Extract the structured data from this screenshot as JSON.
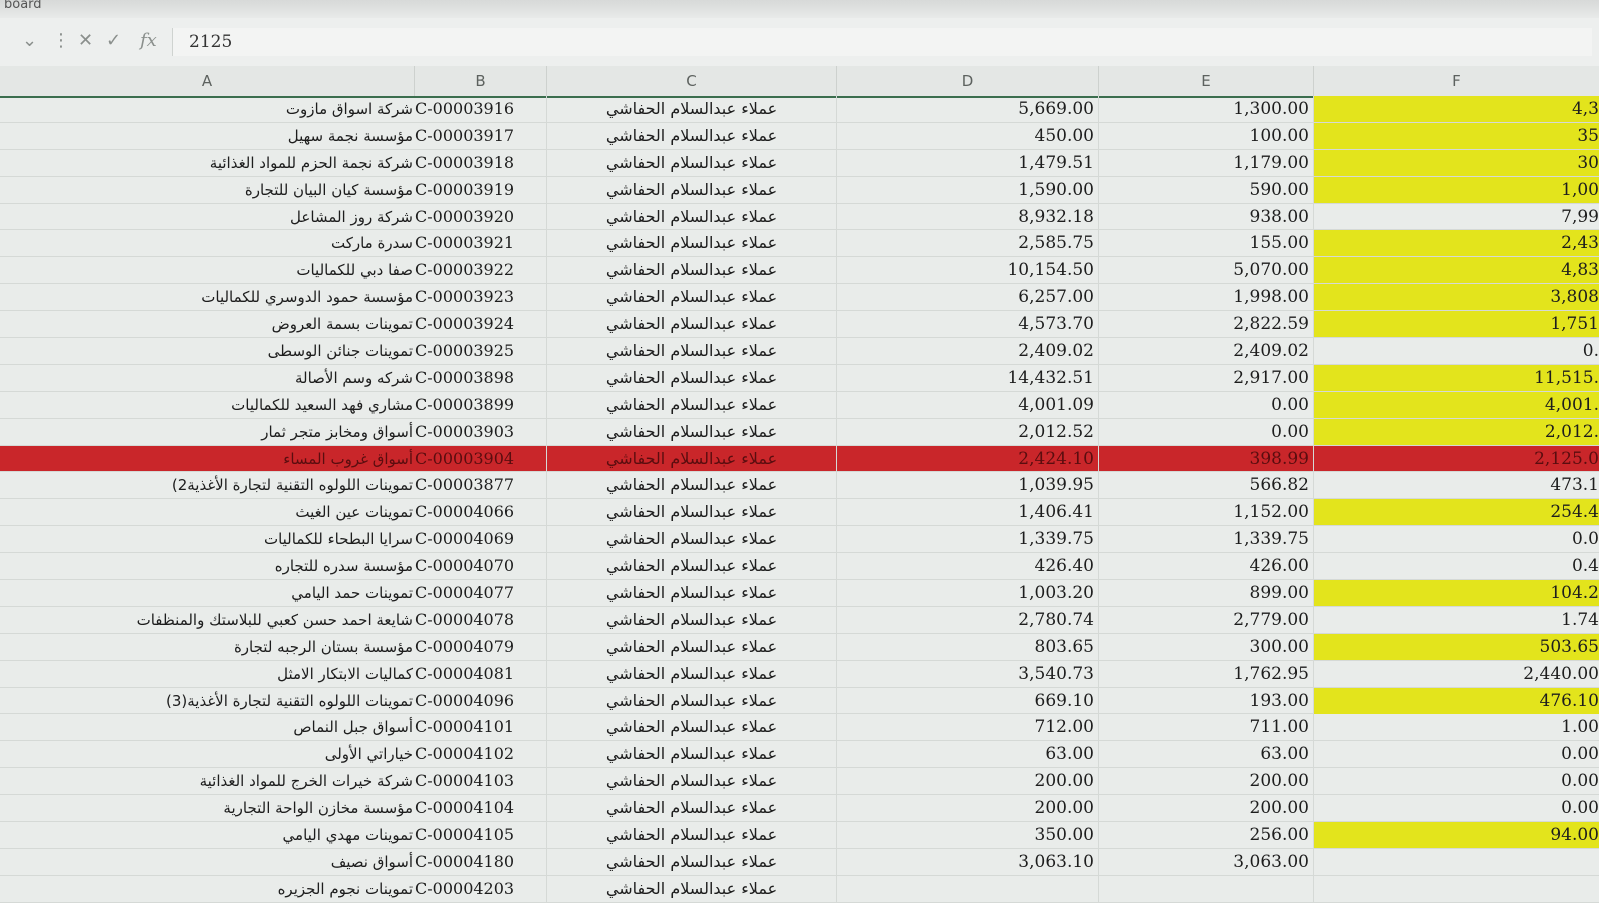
{
  "window": {
    "title_fragment": "board"
  },
  "formula_bar": {
    "fx_label": "fx",
    "value": "2125"
  },
  "columns": [
    "A",
    "B",
    "C",
    "D",
    "E",
    "F"
  ],
  "rows": [
    {
      "a": "شركة اسواق مازوت",
      "b": "C-00003916",
      "c": "عملاء عبدالسلام الحفاشي",
      "d": "5,669.00",
      "e": "1,300.00",
      "f": "4,3",
      "fy": true
    },
    {
      "a": "مؤسسة نجمة سهيل",
      "b": "C-00003917",
      "c": "عملاء عبدالسلام الحفاشي",
      "d": "450.00",
      "e": "100.00",
      "f": "35",
      "fy": true
    },
    {
      "a": "شركة نجمة الحزم للمواد الغذائية",
      "b": "C-00003918",
      "c": "عملاء عبدالسلام الحفاشي",
      "d": "1,479.51",
      "e": "1,179.00",
      "f": "30",
      "fy": true
    },
    {
      "a": "مؤسسة كيان البيان للتجارة",
      "b": "C-00003919",
      "c": "عملاء عبدالسلام الحفاشي",
      "d": "1,590.00",
      "e": "590.00",
      "f": "1,00",
      "fy": true
    },
    {
      "a": "شركة روز المشاعل",
      "b": "C-00003920",
      "c": "عملاء عبدالسلام الحفاشي",
      "d": "8,932.18",
      "e": "938.00",
      "f": "7,99",
      "fy": false
    },
    {
      "a": "سدرة ماركت",
      "b": "C-00003921",
      "c": "عملاء عبدالسلام الحفاشي",
      "d": "2,585.75",
      "e": "155.00",
      "f": "2,43",
      "fy": true
    },
    {
      "a": "صفا دبي للكماليات",
      "b": "C-00003922",
      "c": "عملاء عبدالسلام الحفاشي",
      "d": "10,154.50",
      "e": "5,070.00",
      "f": "4,83",
      "fy": true
    },
    {
      "a": "مؤسسة حمود الدوسري للكماليات",
      "b": "C-00003923",
      "c": "عملاء عبدالسلام الحفاشي",
      "d": "6,257.00",
      "e": "1,998.00",
      "f": "3,808",
      "fy": true
    },
    {
      "a": "تموينات بسمة العروض",
      "b": "C-00003924",
      "c": "عملاء عبدالسلام الحفاشي",
      "d": "4,573.70",
      "e": "2,822.59",
      "f": "1,751",
      "fy": true
    },
    {
      "a": "تموينات جنائن الوسطى",
      "b": "C-00003925",
      "c": "عملاء عبدالسلام الحفاشي",
      "d": "2,409.02",
      "e": "2,409.02",
      "f": "0.",
      "fy": false
    },
    {
      "a": "شركه وسم الأصالة",
      "b": "C-00003898",
      "c": "عملاء عبدالسلام الحفاشي",
      "d": "14,432.51",
      "e": "2,917.00",
      "f": "11,515.",
      "fy": true
    },
    {
      "a": "مشاري فهد السعيد للكماليات",
      "b": "C-00003899",
      "c": "عملاء عبدالسلام الحفاشي",
      "d": "4,001.09",
      "e": "0.00",
      "f": "4,001.",
      "fy": true
    },
    {
      "a": "أسواق ومخابز متجر ثمار",
      "b": "C-00003903",
      "c": "عملاء عبدالسلام الحفاشي",
      "d": "2,012.52",
      "e": "0.00",
      "f": "2,012.",
      "fy": true
    },
    {
      "a": "أسواق غروب المساء",
      "b": "C-00003904",
      "c": "عملاء عبدالسلام الحفاشي",
      "d": "2,424.10",
      "e": "398.99",
      "f": "2,125.0",
      "fy": false,
      "hl": true
    },
    {
      "a": "تموينات اللولوه التقنية لتجارة الأغذية2)",
      "b": "C-00003877",
      "c": "عملاء عبدالسلام الحفاشي",
      "d": "1,039.95",
      "e": "566.82",
      "f": "473.1",
      "fy": false
    },
    {
      "a": "تموينات عين الغيث",
      "b": "C-00004066",
      "c": "عملاء عبدالسلام الحفاشي",
      "d": "1,406.41",
      "e": "1,152.00",
      "f": "254.4",
      "fy": true
    },
    {
      "a": "سرايا البطحاء للكماليات",
      "b": "C-00004069",
      "c": "عملاء عبدالسلام الحفاشي",
      "d": "1,339.75",
      "e": "1,339.75",
      "f": "0.0",
      "fy": false
    },
    {
      "a": "مؤسسة سدره للتجاره",
      "b": "C-00004070",
      "c": "عملاء عبدالسلام الحفاشي",
      "d": "426.40",
      "e": "426.00",
      "f": "0.4",
      "fy": false
    },
    {
      "a": "تموينات حمد اليامي",
      "b": "C-00004077",
      "c": "عملاء عبدالسلام الحفاشي",
      "d": "1,003.20",
      "e": "899.00",
      "f": "104.2",
      "fy": true
    },
    {
      "a": "شايعة احمد حسن كعبي للبلاستك والمنظفات",
      "b": "C-00004078",
      "c": "عملاء عبدالسلام الحفاشي",
      "d": "2,780.74",
      "e": "2,779.00",
      "f": "1.74",
      "fy": false
    },
    {
      "a": "مؤسسة بستان الرجبه لتجارة",
      "b": "C-00004079",
      "c": "عملاء عبدالسلام الحفاشي",
      "d": "803.65",
      "e": "300.00",
      "f": "503.65",
      "fy": true
    },
    {
      "a": "كماليات الابتكار الامثل",
      "b": "C-00004081",
      "c": "عملاء عبدالسلام الحفاشي",
      "d": "3,540.73",
      "e": "1,762.95",
      "f": "2,440.00",
      "fy": false
    },
    {
      "a": "تموينات اللولوه التقنية لتجارة الأغذية(3)",
      "b": "C-00004096",
      "c": "عملاء عبدالسلام الحفاشي",
      "d": "669.10",
      "e": "193.00",
      "f": "476.10",
      "fy": true
    },
    {
      "a": "أسواق جبل النماص",
      "b": "C-00004101",
      "c": "عملاء عبدالسلام الحفاشي",
      "d": "712.00",
      "e": "711.00",
      "f": "1.00",
      "fy": false
    },
    {
      "a": "خياراتي الأولى",
      "b": "C-00004102",
      "c": "عملاء عبدالسلام الحفاشي",
      "d": "63.00",
      "e": "63.00",
      "f": "0.00",
      "fy": false
    },
    {
      "a": "شركة خيرات الخرج للمواد الغذائية",
      "b": "C-00004103",
      "c": "عملاء عبدالسلام الحفاشي",
      "d": "200.00",
      "e": "200.00",
      "f": "0.00",
      "fy": false
    },
    {
      "a": "مؤسسة مخازن الواحة التجارية",
      "b": "C-00004104",
      "c": "عملاء عبدالسلام الحفاشي",
      "d": "200.00",
      "e": "200.00",
      "f": "0.00",
      "fy": false
    },
    {
      "a": "تموينات مهدي اليامي",
      "b": "C-00004105",
      "c": "عملاء عبدالسلام الحفاشي",
      "d": "350.00",
      "e": "256.00",
      "f": "94.00",
      "fy": true
    },
    {
      "a": "أسواق نصيف",
      "b": "C-00004180",
      "c": "عملاء عبدالسلام الحفاشي",
      "d": "3,063.10",
      "e": "3,063.00",
      "f": "",
      "fy": false
    },
    {
      "a": "تموينات نجوم الجزيره",
      "b": "C-00004203",
      "c": "عملاء عبدالسلام الحفاشي",
      "d": "",
      "e": "",
      "f": "",
      "fy": false
    }
  ]
}
